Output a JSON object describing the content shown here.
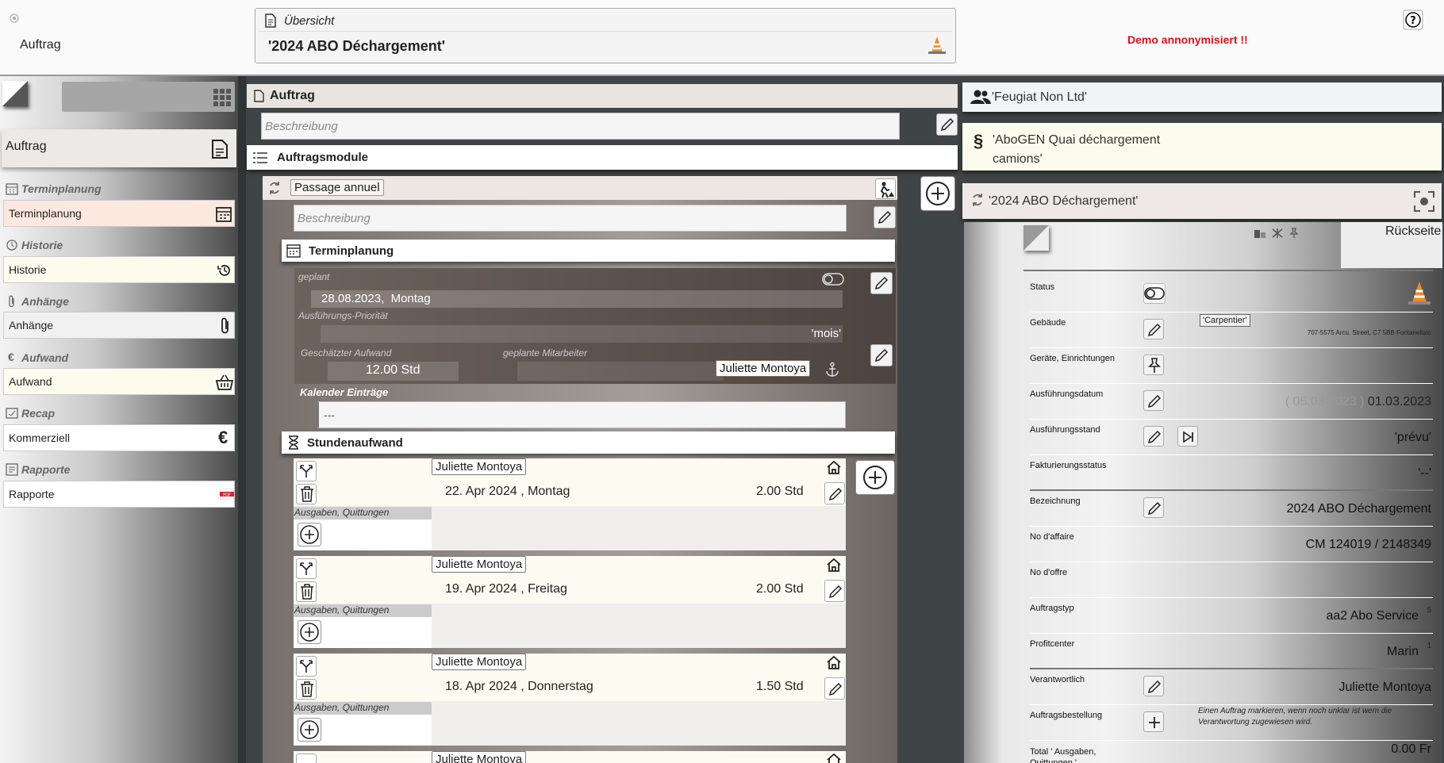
{
  "colors": {
    "accent_red": "#e0101a",
    "cone_orange": "#f08a24"
  },
  "topbar": {
    "app_title": "Auftrag",
    "overview_label": "Übersicht",
    "overview_value": "'2024 ABO Déchargement'",
    "demo_text": "Demo annonymisiert !!"
  },
  "sidebar": {
    "header": "Auftrag",
    "sections": [
      {
        "title": "Terminplanung",
        "item": "Terminplanung",
        "icon": "calendar-icon"
      },
      {
        "title": "Historie",
        "item": "Historie",
        "icon": "history-icon"
      },
      {
        "title": "Anhänge",
        "item": "Anhänge",
        "icon": "paperclip-icon"
      },
      {
        "title": "Aufwand",
        "item": "Aufwand",
        "icon": "basket-icon"
      },
      {
        "title": "Recap",
        "item": "Kommerziell",
        "icon": "euro-icon"
      },
      {
        "title": "Rapporte",
        "item": "Rapporte",
        "icon": "pdf-icon"
      }
    ]
  },
  "main": {
    "title": "Auftrag",
    "desc_placeholder": "Beschreibung",
    "modules_title": "Auftragsmodule",
    "module": {
      "name": "Passage annuel",
      "desc_placeholder": "Beschreibung",
      "terminplanung": {
        "title": "Terminplanung",
        "planned_label": "geplant",
        "planned_value": "28.08.2023,  Montag",
        "priority_label": "Ausführungs-Priorität",
        "priority_value": "'mois'",
        "effort_label": "Geschätzter Aufwand",
        "effort_value": "12.00 Std",
        "staff_label": "geplante Mitarbeiter",
        "staff_value": "Juliette Montoya",
        "calendar_label": "Kalender Einträge",
        "calendar_value": "---"
      },
      "stunden": {
        "title": "Stundenaufwand",
        "expenses_label": "Ausgaben, Quittungen",
        "entries": [
          {
            "person": "Juliette Montoya",
            "date": "22. Apr 2024 , Montag",
            "hours": "2.00 Std"
          },
          {
            "person": "Juliette Montoya",
            "date": "19. Apr 2024 , Freitag",
            "hours": "2.00 Std"
          },
          {
            "person": "Juliette Montoya",
            "date": "18. Apr 2024 , Donnerstag",
            "hours": "1.50 Std"
          },
          {
            "person": "Juliette Montoya"
          }
        ]
      }
    }
  },
  "right": {
    "client": "'Feugiat Non Ltd'",
    "contract": "'AboGEN Quai déchargement camions'",
    "order": "'2024 ABO Déchargement'",
    "back_label": "Rückseite",
    "rows": [
      {
        "label": "Status",
        "value": ""
      },
      {
        "label": "Gebäude",
        "tag": "'Carpentier'",
        "sub": "707-5575 Arcu. Street, C7 5BB Fontanellato"
      },
      {
        "label": "Geräte, Einrichtungen",
        "value": ""
      },
      {
        "label": "Ausführungsdatum",
        "value_prev": "( 05.03.2023 )",
        "value": "01.03.2023"
      },
      {
        "label": "Ausführungsstand",
        "value": "'prévu'"
      },
      {
        "label": "Fakturierungsstatus",
        "value": "'--'"
      },
      {
        "label": "Bezeichnung",
        "value": "2024 ABO Déchargement"
      },
      {
        "label": "No d'affaire",
        "value": "CM 124019 / 2148349"
      },
      {
        "label": "No d'offre",
        "value": ""
      },
      {
        "label": "Auftragstyp",
        "value": "aa2 Abo Service",
        "sup": "5"
      },
      {
        "label": "Profitcenter",
        "value": "Marin",
        "sup": "1"
      },
      {
        "label": "Verantwortlich",
        "value": "Juliette Montoya"
      },
      {
        "label": "Auftragsbestellung",
        "note": "Einen Auftrag markieren, wenn noch unklar ist wem die Verantwortung zugewiesen wird."
      },
      {
        "label": "Total ' Ausgaben, Quittungen '",
        "value": "0.00 Fr"
      }
    ]
  }
}
